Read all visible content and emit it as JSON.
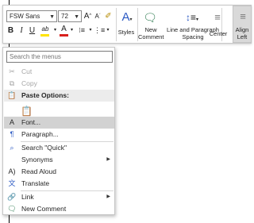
{
  "toolbar": {
    "font_name": "FSW Sans",
    "font_size": "72",
    "grow_font": "A",
    "shrink_font": "A",
    "clear_format": "✐",
    "bold": "B",
    "italic": "I",
    "underline": "U",
    "highlight": "ab",
    "font_color": "A",
    "styles_label": "Styles",
    "new_comment_label": "New Comment",
    "line_spacing_label": "Line and Paragraph Spacing",
    "center_label": "Center",
    "align_left_label": "Align Left",
    "highlight_color": "#ffe400",
    "font_color_value": "#d9201d"
  },
  "menu": {
    "search_placeholder": "Search the menus",
    "items": {
      "cut": "Cut",
      "copy": "Copy",
      "paste_options": "Paste Options:",
      "font": "Font...",
      "paragraph": "Paragraph...",
      "search": "Search \"Quick\"",
      "synonyms": "Synonyms",
      "read_aloud": "Read Aloud",
      "translate": "Translate",
      "link": "Link",
      "new_comment": "New Comment"
    }
  }
}
